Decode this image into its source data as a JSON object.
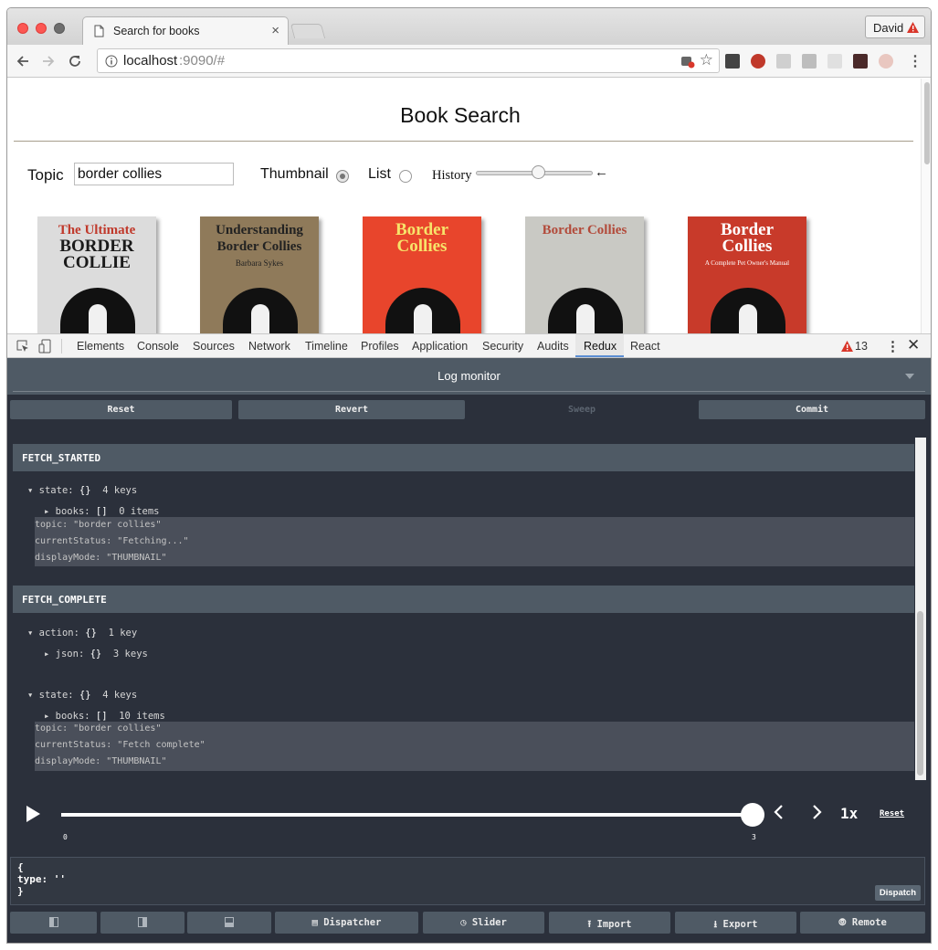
{
  "browser": {
    "tab_title": "Search for books",
    "user": "David",
    "url_host": "localhost",
    "url_rest": ":9090/#"
  },
  "page": {
    "title": "Book Search",
    "topic_label": "Topic",
    "topic_value": "border collies",
    "thumbnail_label": "Thumbnail",
    "list_label": "List",
    "history_label": "History",
    "history_arrow": "←",
    "history_position": 0.53,
    "display_mode": "THUMBNAIL"
  },
  "covers": [
    {
      "bg": "#dcdcdc",
      "line1": "The Ultimate",
      "line2": "BORDER",
      "line3": "COLLIE",
      "color": "#1a1a1a",
      "accent": "#c0392b"
    },
    {
      "bg": "#8f7a5a",
      "line1": "Understanding",
      "line2": "Border Collies",
      "line3": "Barbara Sykes",
      "color": "#222222",
      "accent": "#222222"
    },
    {
      "bg": "#e8452c",
      "line1": "Border",
      "line2": "Collies",
      "line3": "",
      "color": "#f7e36a",
      "accent": "#f7e36a"
    },
    {
      "bg": "#c9c9c4",
      "line1": "Border Collies",
      "line2": "",
      "line3": "",
      "color": "#e8e8e8",
      "accent": "#b24a3a"
    },
    {
      "bg": "#c83a2a",
      "line1": "Border",
      "line2": "Collies",
      "line3": "A Complete Pet Owner's Manual",
      "color": "#ffffff",
      "accent": "#ffffff"
    }
  ],
  "devtools": {
    "tabs": [
      "Elements",
      "Console",
      "Sources",
      "Network",
      "Timeline",
      "Profiles",
      "Application",
      "Security",
      "Audits",
      "Redux",
      "React"
    ],
    "active_tab": "Redux",
    "warning_count": "13",
    "warning_color": "#d9372b"
  },
  "log_monitor": {
    "title": "Log monitor",
    "buttons": {
      "reset": "Reset",
      "revert": "Revert",
      "sweep": "Sweep",
      "commit": "Commit"
    },
    "actions": [
      {
        "name": "FETCH_STARTED",
        "state_label": "state:",
        "state_type": "{}",
        "state_count": "4 keys",
        "books_label": "books:",
        "books_type": "[]",
        "books_count": "0 items",
        "topic": "topic: \"border collies\"",
        "status": "currentStatus: \"Fetching...\"",
        "mode": "displayMode: \"THUMBNAIL\""
      },
      {
        "name": "FETCH_COMPLETE",
        "action_label": "action:",
        "action_type": "{}",
        "action_count": "1 key",
        "json_label": "json:",
        "json_type": "{}",
        "json_count": "3 keys",
        "state_label": "state:",
        "state_type": "{}",
        "state_count": "4 keys",
        "books_label": "books:",
        "books_type": "[]",
        "books_count": "10 items",
        "topic": "topic: \"border collies\"",
        "status": "currentStatus: \"Fetch complete\"",
        "mode": "displayMode: \"THUMBNAIL\""
      }
    ]
  },
  "slider_monitor": {
    "min_label": "0",
    "max_label": "3",
    "position": 3,
    "max": 3,
    "speed": "1x",
    "reset": "Reset"
  },
  "dispatcher": {
    "line1": "{",
    "line2": "type: ''",
    "line3": "}",
    "dispatch": "Dispatch"
  },
  "bottom_buttons": {
    "dispatcher": "Dispatcher",
    "slider": "Slider",
    "import": "Import",
    "export": "Export",
    "remote": "Remote"
  }
}
